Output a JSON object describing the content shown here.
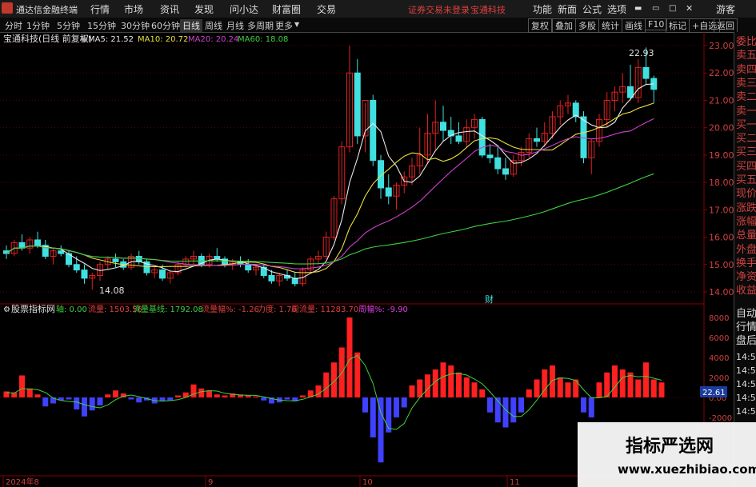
{
  "menu": {
    "app_name": "通达信金融终端",
    "items": [
      "行情",
      "市场",
      "资讯",
      "发现",
      "问小达",
      "财富圈",
      "交易"
    ],
    "notice": [
      "证券交易未登录",
      "宝通科技"
    ],
    "right_items": [
      "功能",
      "新面",
      "公式",
      "选项",
      "游客"
    ]
  },
  "toolbar": {
    "periods": [
      "分时",
      "1分钟",
      "5分钟",
      "15分钟",
      "30分钟",
      "60分钟",
      "日线",
      "周线",
      "月线",
      "多周期",
      "更多"
    ],
    "active_period": "日线",
    "right_buttons": [
      "复权",
      "叠加",
      "多股",
      "统计",
      "画线",
      "F10",
      "标记",
      "+自选",
      "返回"
    ]
  },
  "main_chart": {
    "stock_label": "宝通科技(日线 前复权)",
    "ma_legend": [
      {
        "label": "MA5: 21.52",
        "color": "#e8e8e8"
      },
      {
        "label": "MA10: 20.72",
        "color": "#e8e040"
      },
      {
        "label": "MA20: 20.24",
        "color": "#d040d0"
      },
      {
        "label": "MA60: 18.08",
        "color": "#40d040"
      }
    ],
    "price_axis": [
      "23.00",
      "22.00",
      "21.00",
      "20.00",
      "19.00",
      "18.00",
      "17.00",
      "16.00",
      "15.00",
      "14.00"
    ],
    "high_label": "22.93",
    "low_label": "14.08",
    "event_marker": "财"
  },
  "sub_chart": {
    "indicator_name": "股票指标网",
    "legend": [
      {
        "label": "轴: 0.00",
        "color": "#40d040"
      },
      {
        "label": "流量: 1503.56",
        "color": "#e04040"
      },
      {
        "label": "流量基线: 1792.08",
        "color": "#40d040"
      },
      {
        "label": "流量幅%: -1.26",
        "color": "#e04040"
      },
      {
        "label": "力度: 1.76",
        "color": "#e04040"
      },
      {
        "label": "周流量: 11283.70",
        "color": "#e04040"
      },
      {
        "label": "周幅%: -9.90",
        "color": "#e040e0"
      }
    ],
    "axis": [
      "8000",
      "6000",
      "4000",
      "2000",
      "0.00",
      "-2000"
    ],
    "current_value": "22.61"
  },
  "date_axis": [
    "2024年8",
    "9",
    "10",
    "11"
  ],
  "right_panel": {
    "items": [
      "委比",
      "卖五",
      "卖四",
      "卖三",
      "卖二",
      "卖一",
      "买一",
      "买二",
      "买三",
      "买四",
      "买五",
      "现价",
      "涨跌",
      "涨幅",
      "总量",
      "外盘",
      "换手",
      "净资",
      "收益"
    ],
    "items2": [
      "自动",
      "行情",
      "盘后"
    ],
    "times": [
      "14:50",
      "14:50",
      "14:50",
      "14:50",
      "14:50"
    ]
  },
  "watermark": {
    "title": "指标严选网",
    "url": "www.xuezhibiao.com"
  },
  "colors": {
    "up": "#e02020",
    "down": "#40e0e0",
    "bar_up": "#ff2020",
    "bar_down": "#4040ff"
  },
  "chart_data": {
    "type": "candlestick",
    "ohlc": [
      [
        15.5,
        15.7,
        15.2,
        15.4
      ],
      [
        15.4,
        15.9,
        15.3,
        15.8
      ],
      [
        15.8,
        16.1,
        15.5,
        15.6
      ],
      [
        15.6,
        16.0,
        15.4,
        15.9
      ],
      [
        15.9,
        16.2,
        15.6,
        15.7
      ],
      [
        15.7,
        15.9,
        15.2,
        15.3
      ],
      [
        15.3,
        15.6,
        15.0,
        15.5
      ],
      [
        15.5,
        15.7,
        15.3,
        15.4
      ],
      [
        15.4,
        15.5,
        14.9,
        15.0
      ],
      [
        15.0,
        15.3,
        14.7,
        14.8
      ],
      [
        14.8,
        15.0,
        14.3,
        14.5
      ],
      [
        14.5,
        14.7,
        14.08,
        14.6
      ],
      [
        14.6,
        15.1,
        14.4,
        15.0
      ],
      [
        15.0,
        15.3,
        14.8,
        15.2
      ],
      [
        15.2,
        15.4,
        14.9,
        15.1
      ],
      [
        15.1,
        15.2,
        14.8,
        14.9
      ],
      [
        14.9,
        15.4,
        14.8,
        15.3
      ],
      [
        15.3,
        15.5,
        15.0,
        15.1
      ],
      [
        15.1,
        15.2,
        14.6,
        14.7
      ],
      [
        14.7,
        14.9,
        14.5,
        14.8
      ],
      [
        14.8,
        15.0,
        14.4,
        14.5
      ],
      [
        14.5,
        14.8,
        14.3,
        14.7
      ],
      [
        14.7,
        15.1,
        14.6,
        15.0
      ],
      [
        15.0,
        15.3,
        14.9,
        15.2
      ],
      [
        15.2,
        15.5,
        15.0,
        15.3
      ],
      [
        15.3,
        15.4,
        14.9,
        15.0
      ],
      [
        15.0,
        15.4,
        14.9,
        15.3
      ],
      [
        15.3,
        15.6,
        15.1,
        15.2
      ],
      [
        15.2,
        15.3,
        14.9,
        15.0
      ],
      [
        15.0,
        15.2,
        14.8,
        15.1
      ],
      [
        15.1,
        15.3,
        14.9,
        15.0
      ],
      [
        15.0,
        15.2,
        14.7,
        14.8
      ],
      [
        14.8,
        15.0,
        14.6,
        14.9
      ],
      [
        14.9,
        15.0,
        14.5,
        14.6
      ],
      [
        14.6,
        14.8,
        14.3,
        14.4
      ],
      [
        14.4,
        14.7,
        14.2,
        14.6
      ],
      [
        14.6,
        14.8,
        14.4,
        14.5
      ],
      [
        14.5,
        14.7,
        14.2,
        14.3
      ],
      [
        14.3,
        14.9,
        14.2,
        14.8
      ],
      [
        14.8,
        15.3,
        14.7,
        15.2
      ],
      [
        15.2,
        15.5,
        15.0,
        15.3
      ],
      [
        15.3,
        16.2,
        15.2,
        16.0
      ],
      [
        16.0,
        17.5,
        15.9,
        17.4
      ],
      [
        17.4,
        19.5,
        17.2,
        19.3
      ],
      [
        19.3,
        23.0,
        19.1,
        22.0
      ],
      [
        22.0,
        22.5,
        19.4,
        19.7
      ],
      [
        19.7,
        20.9,
        19.1,
        21.0
      ],
      [
        21.0,
        21.2,
        18.6,
        18.8
      ],
      [
        18.8,
        19.0,
        17.4,
        17.8
      ],
      [
        17.8,
        18.3,
        17.2,
        17.5
      ],
      [
        17.5,
        18.0,
        17.0,
        17.9
      ],
      [
        17.9,
        18.4,
        17.6,
        18.2
      ],
      [
        18.2,
        18.9,
        17.9,
        18.6
      ],
      [
        18.6,
        20.0,
        18.3,
        19.0
      ],
      [
        19.0,
        20.5,
        18.7,
        19.8
      ],
      [
        19.8,
        21.0,
        19.2,
        20.2
      ],
      [
        20.2,
        20.8,
        19.5,
        19.9
      ],
      [
        19.9,
        20.4,
        19.4,
        19.7
      ],
      [
        19.7,
        20.2,
        19.4,
        19.5
      ],
      [
        19.5,
        20.3,
        19.3,
        20.0
      ],
      [
        20.0,
        20.5,
        19.6,
        20.3
      ],
      [
        20.3,
        20.4,
        18.9,
        19.0
      ],
      [
        19.0,
        19.4,
        18.7,
        18.9
      ],
      [
        18.9,
        19.3,
        18.3,
        18.5
      ],
      [
        18.5,
        18.9,
        18.1,
        18.3
      ],
      [
        18.3,
        19.0,
        18.2,
        18.8
      ],
      [
        18.8,
        19.3,
        18.6,
        19.1
      ],
      [
        19.1,
        19.8,
        18.9,
        19.6
      ],
      [
        19.6,
        20.0,
        19.3,
        19.5
      ],
      [
        19.5,
        20.2,
        19.3,
        19.8
      ],
      [
        19.8,
        20.6,
        19.6,
        20.4
      ],
      [
        20.4,
        21.0,
        20.1,
        20.8
      ],
      [
        20.8,
        21.2,
        20.5,
        20.9
      ],
      [
        20.9,
        21.0,
        20.2,
        20.4
      ],
      [
        20.4,
        20.6,
        18.7,
        18.9
      ],
      [
        18.9,
        19.6,
        18.3,
        19.5
      ],
      [
        19.5,
        20.5,
        19.3,
        20.3
      ],
      [
        20.3,
        21.3,
        20.0,
        21.0
      ],
      [
        21.0,
        21.5,
        20.6,
        21.3
      ],
      [
        21.3,
        22.0,
        20.9,
        21.5
      ],
      [
        21.5,
        22.3,
        21.0,
        21.1
      ],
      [
        21.1,
        22.5,
        20.9,
        22.2
      ],
      [
        22.2,
        22.93,
        21.6,
        21.8
      ],
      [
        21.8,
        21.9,
        20.9,
        21.4
      ]
    ],
    "ma_series": [
      "MA5",
      "MA10",
      "MA20",
      "MA60"
    ],
    "flow_values": [
      600,
      500,
      2200,
      900,
      300,
      -900,
      -600,
      -300,
      -200,
      -1200,
      -1900,
      -1300,
      -800,
      300,
      700,
      400,
      -200,
      -500,
      -300,
      -600,
      -400,
      -300,
      200,
      500,
      1300,
      900,
      700,
      300,
      200,
      400,
      300,
      200,
      100,
      -300,
      -600,
      -500,
      -200,
      -400,
      200,
      700,
      1200,
      2500,
      3500,
      5000,
      8000,
      4500,
      -1500,
      -4000,
      -6500,
      -3500,
      -2000,
      -1000,
      1200,
      1800,
      2300,
      2800,
      3500,
      3200,
      2500,
      2000,
      1500,
      800,
      -1500,
      -2500,
      -3000,
      -2500,
      -1500,
      800,
      1800,
      2800,
      3200,
      2000,
      1500,
      1800,
      -1500,
      -2000,
      1500,
      2500,
      3200,
      2800,
      2500,
      1800,
      3500,
      1800,
      1500
    ]
  }
}
